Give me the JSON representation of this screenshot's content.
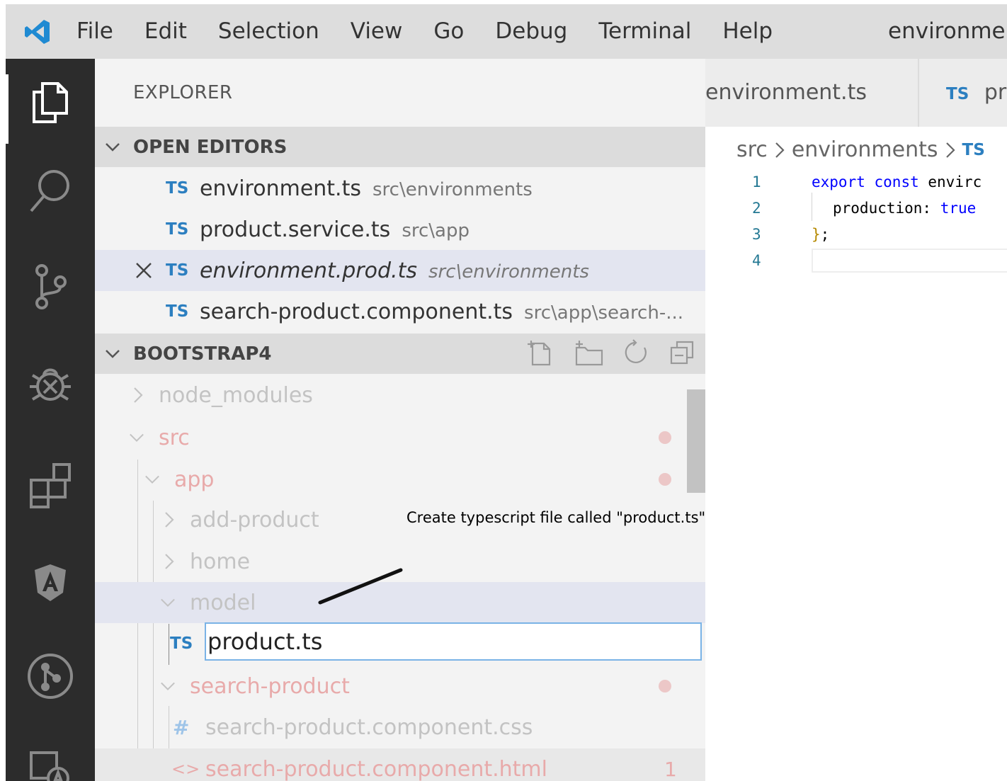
{
  "menu": {
    "items": [
      "File",
      "Edit",
      "Selection",
      "View",
      "Go",
      "Debug",
      "Terminal",
      "Help"
    ],
    "window_title": "environmen"
  },
  "activity_bar": {
    "icons": [
      "explorer-icon",
      "search-icon",
      "source-control-icon",
      "debug-icon",
      "extensions-icon",
      "angular-icon",
      "git-graph-icon",
      "translate-icon"
    ]
  },
  "sidebar": {
    "title": "EXPLORER",
    "open_editors": {
      "label": "OPEN EDITORS",
      "items": [
        {
          "badge": "TS",
          "name": "environment.ts",
          "path": "src\\environments"
        },
        {
          "badge": "TS",
          "name": "product.service.ts",
          "path": "src\\app"
        },
        {
          "badge": "TS",
          "name": "environment.prod.ts",
          "path": "src\\environments"
        },
        {
          "badge": "TS",
          "name": "search-product.component.ts",
          "path": "src\\app\\search-..."
        }
      ]
    },
    "project": {
      "label": "BOOTSTRAP4",
      "tree": {
        "node_modules": "node_modules",
        "src": "src",
        "app": "app",
        "add_product": "add-product",
        "home": "home",
        "model": "model",
        "new_file_badge": "TS",
        "new_file_value": "product.ts",
        "search_product": "search-product",
        "css_badge": "#",
        "css_file": "search-product.component.css",
        "html_badge": "<>",
        "html_file": "search-product.component.html",
        "html_problems": "1"
      }
    }
  },
  "annotation": "Create typescript file called \"product.ts\".",
  "editor": {
    "tabs": [
      {
        "name": "environment.ts"
      },
      {
        "badge": "TS",
        "name": "pr"
      }
    ],
    "breadcrumb": {
      "part1": "src",
      "part2": "environments",
      "part3_badge": "TS"
    },
    "line_numbers": [
      "1",
      "2",
      "3",
      "4"
    ],
    "code": {
      "l1_kw1": "export",
      "l1_kw2": "const",
      "l1_rest": "envirc",
      "l2_prop": "production: ",
      "l2_val": "true",
      "l3_brace": "}",
      "l3_semi": ";"
    }
  },
  "colors": {
    "activity_bar": "#2c2c2c",
    "menubar": "#dddddd",
    "ts_badge": "#2c7fc0",
    "git_modified": "#e8aaaa",
    "selection": "#e3e5f0",
    "input_border": "#7ab3e6"
  }
}
